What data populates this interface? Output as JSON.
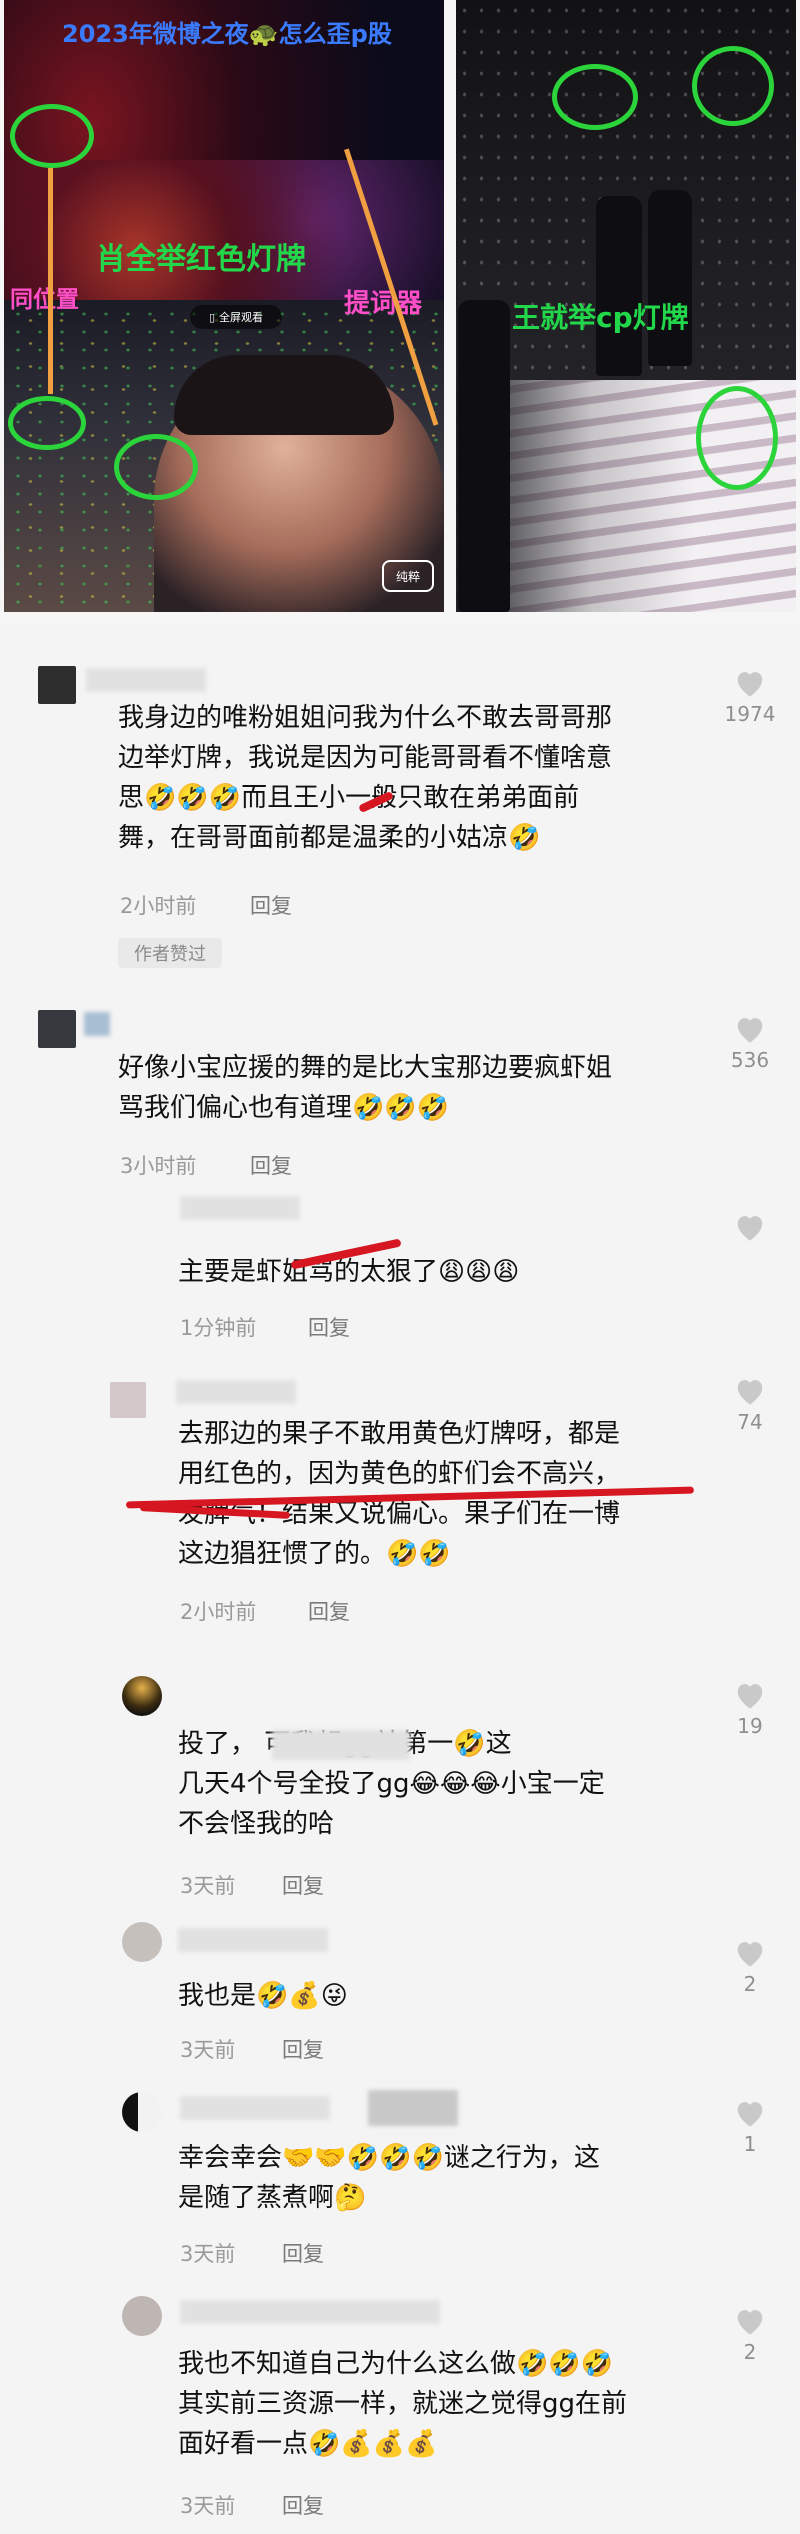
{
  "top_left_image": {
    "title": "2023年微博之夜🐢怎么歪p股",
    "center_label": "肖全举红色灯牌",
    "left_label": "同位置",
    "right_label": "提词器",
    "fullscreen_label": "全屏观看",
    "watermark": "纯粹"
  },
  "top_right_image": {
    "label": "王就举cp灯牌"
  },
  "comments": [
    {
      "text_lines": [
        "我身边的唯粉姐姐问我为什么不敢去哥哥那",
        "边举灯牌，我说是因为可能哥哥看不懂啥意",
        "思🤣🤣🤣而且王小一般只敢在弟弟面前",
        "舞，在哥哥面前都是温柔的小姑凉🤣"
      ],
      "time": "2小时前",
      "reply": "回复",
      "likes": "1974",
      "badge": "作者赞过"
    },
    {
      "text_lines": [
        "好像小宝应援的舞的是比大宝那边要疯虾姐",
        "骂我们偏心也有道理🤣🤣🤣"
      ],
      "time": "3小时前",
      "reply": "回复",
      "likes": "536"
    },
    {
      "text_lines": [
        "主要是虾姐骂的太狠了😩😩😩"
      ],
      "time": "1分钟前",
      "reply": "回复",
      "likes": ""
    },
    {
      "text_lines": [
        "去那边的果子不敢用黄色灯牌呀，都是",
        "用红色的，因为黄色的虾们会不高兴，",
        "发脾气！结果又说偏心。果子们在一博",
        "这边猖狂惯了的。🤣🤣"
      ],
      "time": "2小时前",
      "reply": "回复",
      "likes": "74"
    },
    {
      "text_lines": [
        "投了，                    可我想gg站第一🤣这",
        "几天4个号全投了gg😂😂😂小宝一定",
        "不会怪我的哈"
      ],
      "time": "3天前",
      "reply": "回复",
      "likes": "19"
    },
    {
      "text_lines": [
        "我也是🤣💰😜"
      ],
      "time": "3天前",
      "reply": "回复",
      "likes": "2"
    },
    {
      "text_lines": [
        "幸会幸会🤝🤝🤣🤣🤣谜之行为，这",
        "是随了蒸煮啊🤔"
      ],
      "time": "3天前",
      "reply": "回复",
      "likes": "1"
    },
    {
      "text_lines": [
        "我也不知道自己为什么这么做🤣🤣🤣",
        "其实前三资源一样，就迷之觉得gg在前",
        "面好看一点🤣💰💰💰"
      ],
      "time": "3天前",
      "reply": "回复",
      "likes": "2"
    }
  ],
  "colors": {
    "annotation_green": "#2cd43b",
    "annotation_orange": "#f0a040",
    "title_blue": "#3a7bff",
    "label_green": "#22d84a",
    "label_pink": "#ff4fc8",
    "red_underline": "#d61620"
  }
}
